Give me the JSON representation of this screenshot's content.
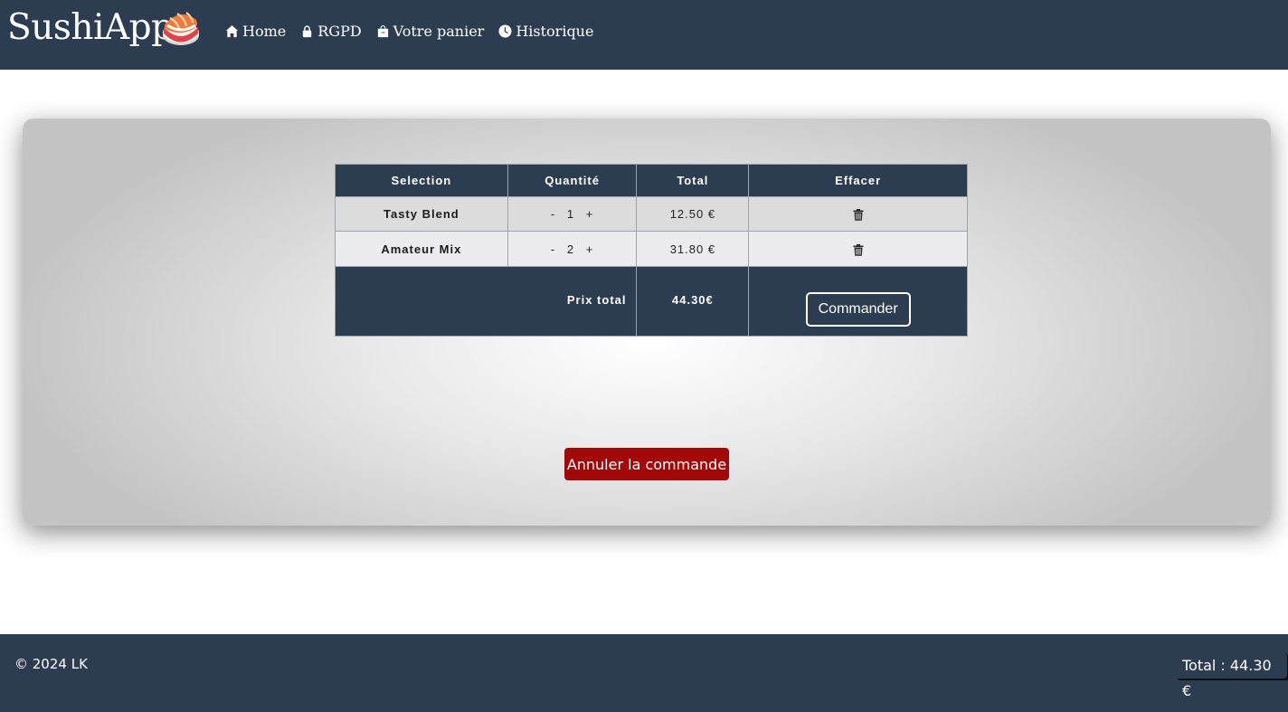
{
  "header": {
    "brand": "SushiApp",
    "nav": [
      {
        "label": "Home",
        "icon": "home-icon"
      },
      {
        "label": "RGPD",
        "icon": "lock-icon"
      },
      {
        "label": "Votre panier",
        "icon": "shopping-bag-icon"
      },
      {
        "label": "Historique",
        "icon": "clock-icon"
      }
    ]
  },
  "cart": {
    "columns": [
      "Selection",
      "Quantité",
      "Total",
      "Effacer"
    ],
    "rows": [
      {
        "name": "Tasty Blend",
        "minus": "-",
        "qty": "1",
        "plus": "+",
        "total": "12.50 €"
      },
      {
        "name": "Amateur Mix",
        "minus": "-",
        "qty": "2",
        "plus": "+",
        "total": "31.80 €"
      }
    ],
    "total_label": "Prix total",
    "total_value": "44.30€",
    "order_label": "Commander"
  },
  "cancel_label": "Annuler la commande",
  "footer": {
    "copyright": "© 2024 LK",
    "total": "Total : 44.30 €"
  },
  "colors": {
    "navy": "#2d3d51",
    "cancel_red": "#a30808"
  }
}
